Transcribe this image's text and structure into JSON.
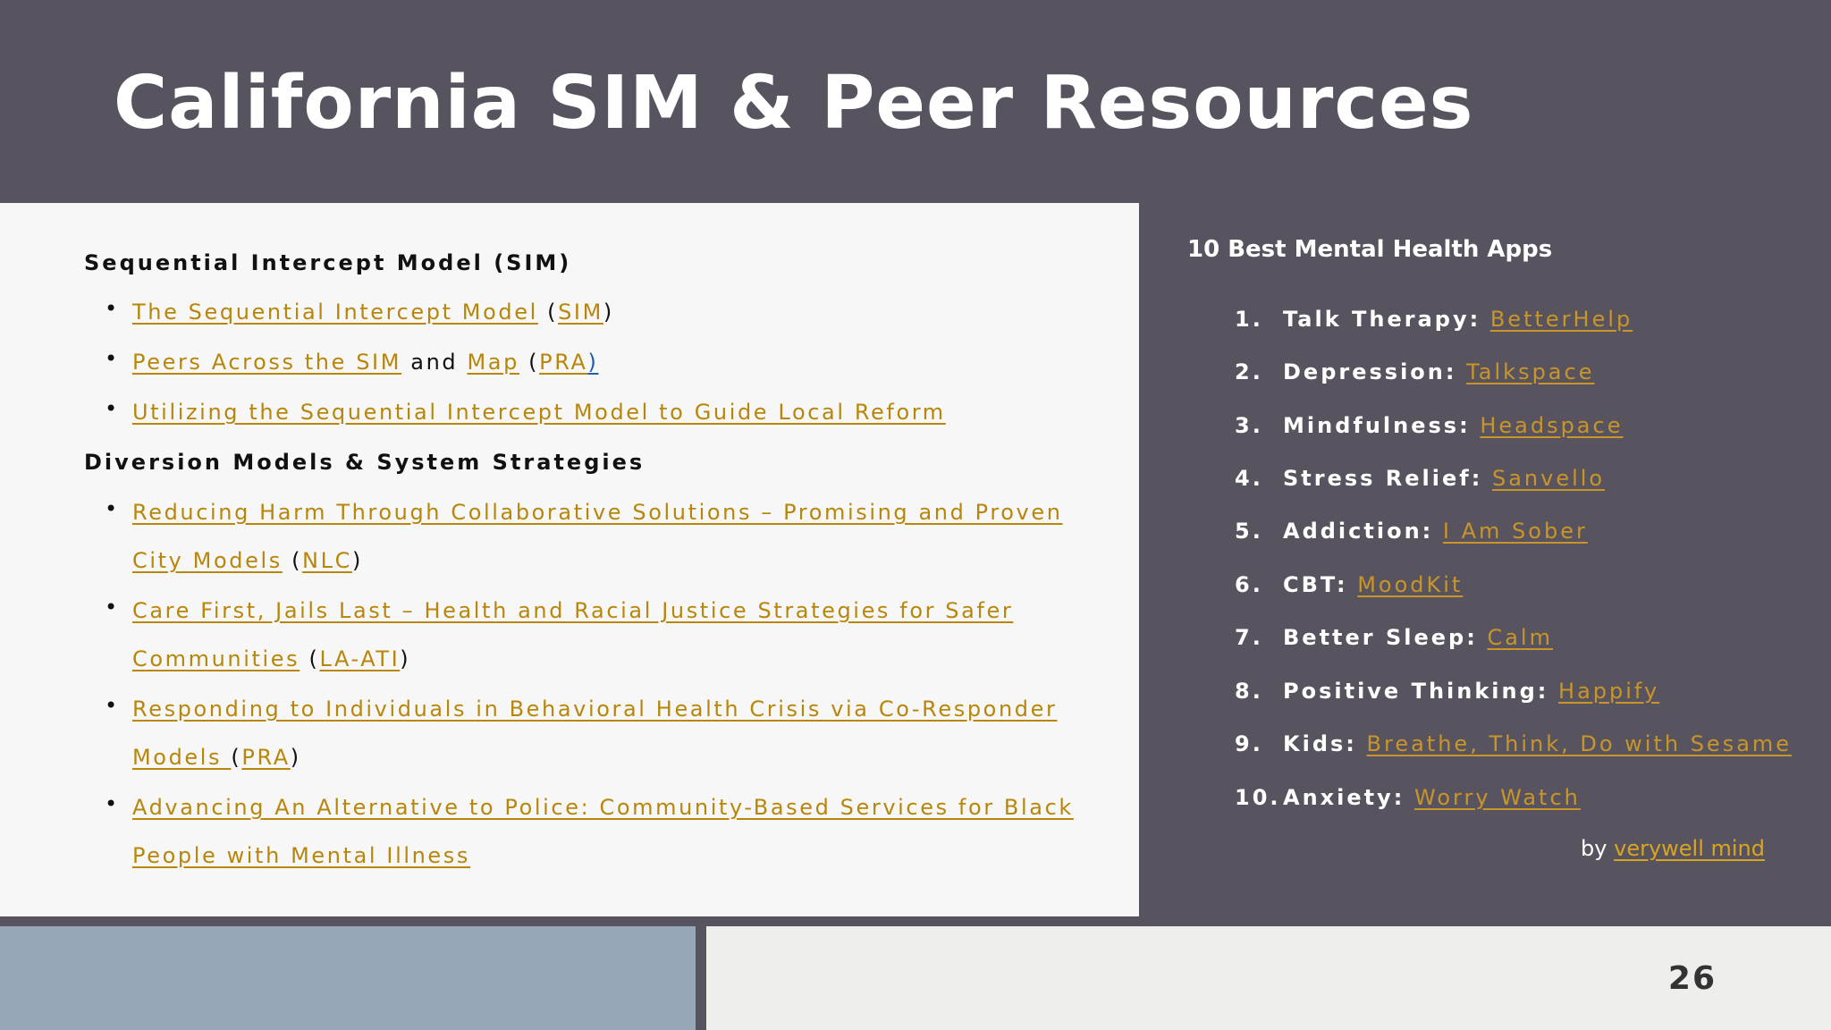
{
  "title": "California SIM & Peer Resources",
  "left": {
    "sim_heading": "Sequential Intercept Model (SIM)",
    "sim_items": [
      {
        "link": "The Sequential Intercept Model",
        "pre": "(",
        "src": "SIM",
        "post": ")"
      },
      {
        "link": "Peers Across the SIM",
        "mid": "and",
        "link2": "Map",
        "pre": "(",
        "src": "PRA",
        "post": ")"
      },
      {
        "link": "Utilizing the Sequential Intercept Model to Guide Local Reform"
      }
    ],
    "div_heading": "Diversion Models & System Strategies",
    "div_items": [
      {
        "line1": "Reducing Harm Through Collaborative Solutions – Promising and Proven",
        "line2": "City Models",
        "pre": "(",
        "src": "NLC",
        "post": ")"
      },
      {
        "line1": "Care First, Jails Last – Health and Racial Justice Strategies for Safer",
        "line2": "Communities",
        "pre": "(",
        "src": "LA-ATI",
        "post": ")"
      },
      {
        "line1": "Responding to Individuals in Behavioral Health Crisis via Co-Responder",
        "line2": "Models ",
        "pre": "(",
        "src": "PRA",
        "post": ")"
      },
      {
        "line1": "Advancing An Alternative to Police: Community-Based Services for Black",
        "line2": "People with Mental Illness"
      }
    ]
  },
  "right": {
    "title": "10 Best Mental Health Apps",
    "apps": [
      {
        "num": "1.",
        "category": "Talk Therapy:",
        "app": "BetterHelp"
      },
      {
        "num": "2.",
        "category": "Depression:",
        "app": "Talkspace"
      },
      {
        "num": "3.",
        "category": "Mindfulness:",
        "app": "Headspace"
      },
      {
        "num": "4.",
        "category": "Stress Relief:",
        "app": "Sanvello"
      },
      {
        "num": "5.",
        "category": "Addiction:",
        "app": "I Am Sober"
      },
      {
        "num": "6.",
        "category": "CBT:",
        "app": "MoodKit"
      },
      {
        "num": "7.",
        "category": "Better Sleep:",
        "app": "Calm"
      },
      {
        "num": "8.",
        "category": "Positive Thinking:",
        "app": "Happify"
      },
      {
        "num": "9.",
        "category": "Kids:",
        "app": "Breathe, Think, Do with Sesame"
      },
      {
        "num": "10.",
        "category": "Anxiety:",
        "app": "Worry Watch"
      }
    ],
    "byline_prefix": "by",
    "byline_link": "verywell mind"
  },
  "page_number": "26"
}
